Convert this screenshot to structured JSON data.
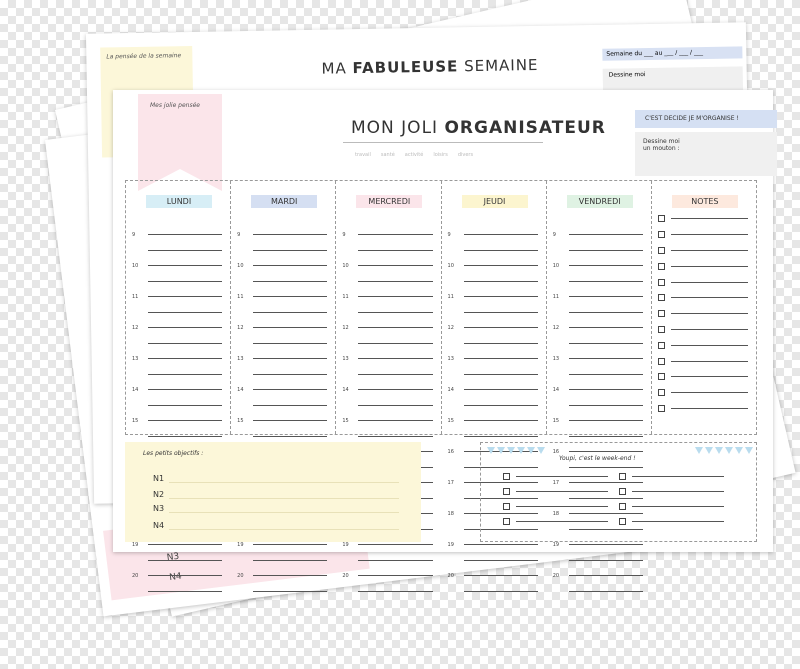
{
  "back_sheets": {
    "back3_items": [
      "N3",
      "N4"
    ],
    "back2_items": [
      "N3",
      "N4"
    ]
  },
  "sheet2": {
    "title_a": "MA ",
    "title_b": "FABULEUSE",
    "title_c": " SEMAINE",
    "thought": "La pensée de la semaine",
    "week": "Semaine du ___ au ___ / ___ / ___",
    "draw": "Dessine moi"
  },
  "front": {
    "title_a": "MON JOLI ",
    "title_b": "ORGANISATEUR",
    "thought": "Mes jolie pensée",
    "subtitles": [
      "travail",
      "santé",
      "activité",
      "loisirs",
      "divers"
    ],
    "decide": "C'EST DECIDE JE M'ORGANISE !",
    "mouton": [
      "Dessine moi",
      "un mouton :"
    ],
    "days": [
      {
        "label": "LUNDI",
        "color": "#d7eef6"
      },
      {
        "label": "MARDI",
        "color": "#d5dff2"
      },
      {
        "label": "MERCREDI",
        "color": "#fbe5ea"
      },
      {
        "label": "JEUDI",
        "color": "#fcf5cf"
      },
      {
        "label": "VENDREDI",
        "color": "#dff2e3"
      }
    ],
    "notes_label": "NOTES",
    "notes_color": "#fde9de",
    "hours": [
      "9",
      "",
      "10",
      "",
      "11",
      "",
      "12",
      "",
      "13",
      "",
      "14",
      "",
      "15",
      "",
      "16",
      "",
      "17",
      "",
      "18",
      "",
      "19",
      "",
      "20",
      ""
    ],
    "objectifs_title": "Les petits objectifs :",
    "objectifs": [
      "N1",
      "N2",
      "N3",
      "N4"
    ],
    "weekend_title": "Youpi, c'est le week-end !"
  },
  "colors": {
    "pink": "#fbe5ea",
    "yellow": "#fcf7d9",
    "blue": "#d5e0f3",
    "bunting": "#b9dcee"
  }
}
